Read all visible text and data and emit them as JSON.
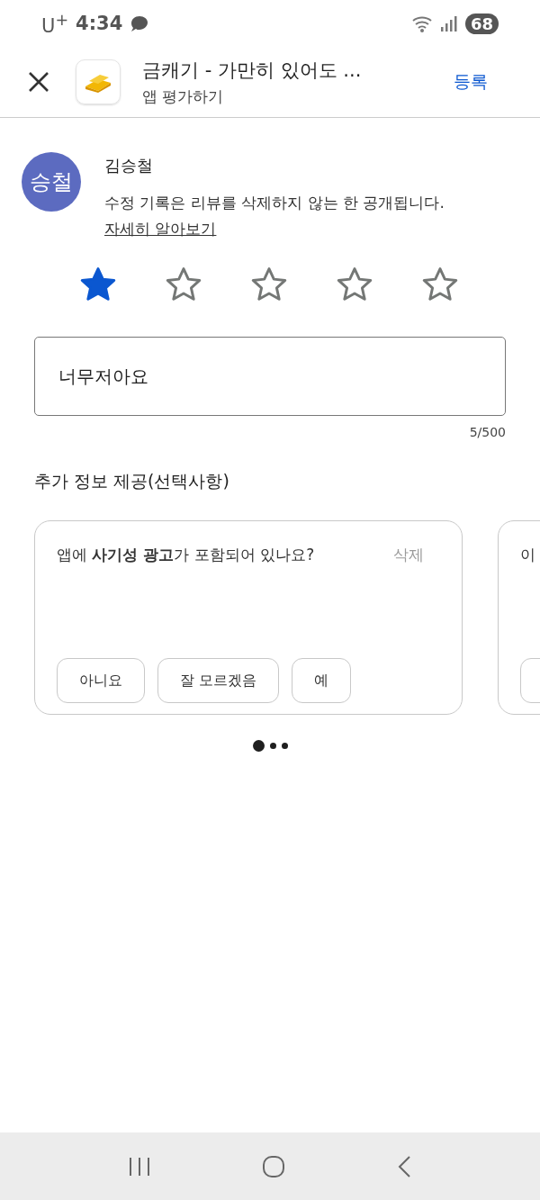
{
  "status_bar": {
    "carrier": "U$^{+}$",
    "time": "4:34",
    "battery": "68"
  },
  "header": {
    "title": "금캐기 - 가만히 있어도 ...",
    "subtitle": "앱 평가하기",
    "submit": "등록"
  },
  "author": {
    "avatar": "승철",
    "name": "김승철",
    "notice": "수정 기록은 리뷰를 삭제하지 않는 한 공개됩니다.",
    "link": "자세히 알아보기"
  },
  "rating": {
    "stars": 1
  },
  "review": {
    "value": "너무저아요",
    "counter": "5/500"
  },
  "section_title": "추가 정보 제공(선택사항)",
  "question_cards": [
    {
      "question": "앱에 **사기성 광고**가 포함되어 있나요?",
      "dismiss": "삭제",
      "options": [
        "아니요",
        "잘 모르겠음",
        "예"
      ]
    },
    {
      "question": "이",
      "cut_off_button": true
    }
  ],
  "pager": [
    {
      "selected": true
    },
    {
      "selected": false
    },
    {
      "selected": false
    }
  ]
}
